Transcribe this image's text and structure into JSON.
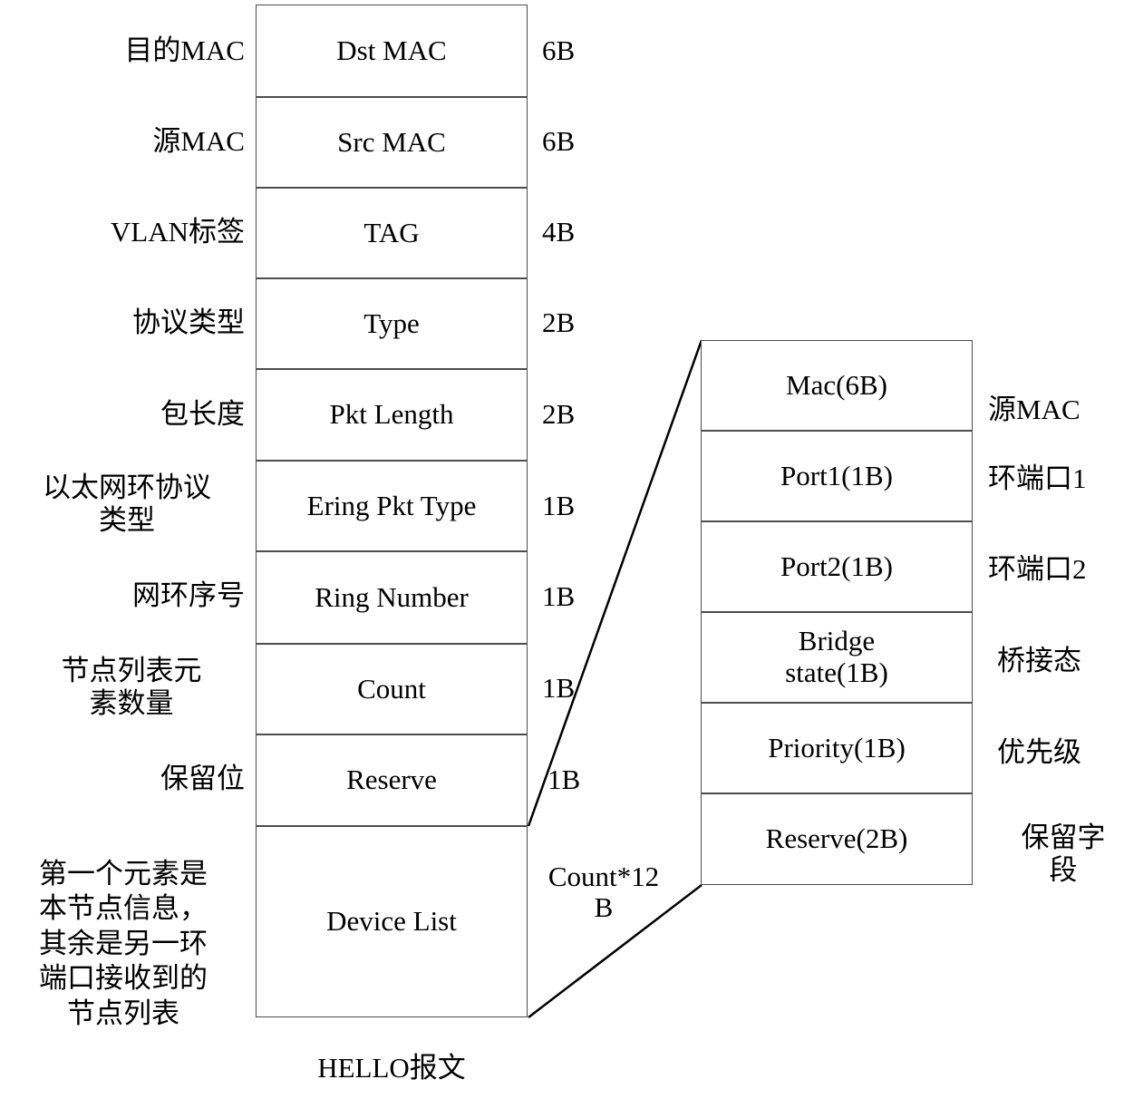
{
  "diagram": {
    "caption": "HELLO报文",
    "note": "第一个元素是\n本节点信息，\n其余是另一环\n端口接收到的\n节点列表"
  },
  "packet_table": {
    "rows": [
      {
        "cn_label": "目的MAC",
        "field": "Dst MAC",
        "size": "6B"
      },
      {
        "cn_label": "源MAC",
        "field": "Src MAC",
        "size": "6B"
      },
      {
        "cn_label": "VLAN标签",
        "field": "TAG",
        "size": "4B"
      },
      {
        "cn_label": "协议类型",
        "field": "Type",
        "size": "2B"
      },
      {
        "cn_label": "包长度",
        "field": "Pkt Length",
        "size": "2B"
      },
      {
        "cn_label": "以太网环协议\n类型",
        "field": "Ering Pkt Type",
        "size": "1B"
      },
      {
        "cn_label": "网环序号",
        "field": "Ring Number",
        "size": "1B"
      },
      {
        "cn_label": "节点列表元\n素数量",
        "field": "Count",
        "size": "1B"
      },
      {
        "cn_label": "保留位",
        "field": "Reserve",
        "size": "1B"
      },
      {
        "cn_label": "",
        "field": "Device List",
        "size": "Count*12\nB"
      }
    ]
  },
  "device_entry_table": {
    "rows": [
      {
        "field": "Mac(6B)",
        "cn_label": "源MAC"
      },
      {
        "field": "Port1(1B)",
        "cn_label": "环端口1"
      },
      {
        "field": "Port2(1B)",
        "cn_label": "环端口2"
      },
      {
        "field": "Bridge\nstate(1B)",
        "cn_label": "桥接态"
      },
      {
        "field": "Priority(1B)",
        "cn_label": "优先级"
      },
      {
        "field": "Reserve(2B)",
        "cn_label": "保留字\n段"
      }
    ]
  }
}
